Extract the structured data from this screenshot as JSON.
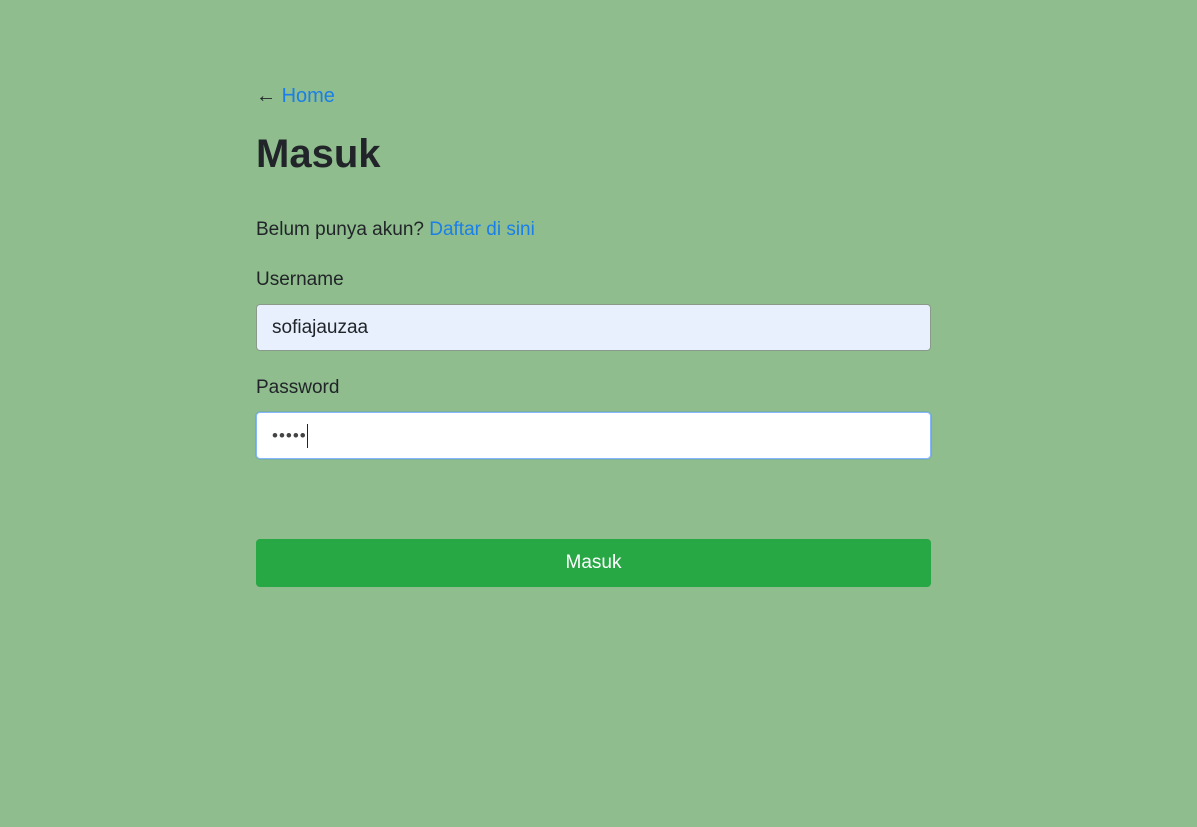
{
  "back": {
    "arrow": "←",
    "link_label": "Home"
  },
  "page": {
    "title": "Masuk"
  },
  "register": {
    "prompt": "Belum punya akun?",
    "link_label": "Daftar di sini"
  },
  "form": {
    "username_label": "Username",
    "username_value": "sofiajauzaa",
    "password_label": "Password",
    "password_masked": "•••••",
    "submit_label": "Masuk"
  },
  "colors": {
    "background": "#8fbd8d",
    "link": "#1a7fe8",
    "submit_button": "#28a745",
    "username_autofill": "#e8f0fe"
  }
}
